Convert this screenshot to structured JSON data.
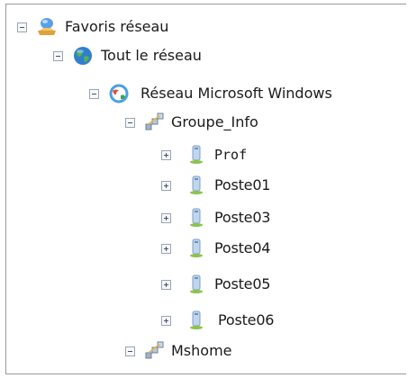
{
  "tree": {
    "favoris": {
      "label": "Favoris réseau",
      "icon": "network-favorites-icon",
      "expander": "-"
    },
    "tout": {
      "label": "Tout le réseau",
      "icon": "globe-icon",
      "expander": "-"
    },
    "msnet": {
      "label": "Réseau Microsoft Windows",
      "icon": "network-globe-icon",
      "expander": "-"
    },
    "groupe_info": {
      "label": "Groupe_Info",
      "icon": "workgroup-icon",
      "expander": "-"
    },
    "computers": [
      {
        "label": "Prof",
        "icon": "computer-icon",
        "expander": "+"
      },
      {
        "label": "Poste01",
        "icon": "computer-icon",
        "expander": "+"
      },
      {
        "label": "Poste03",
        "icon": "computer-icon",
        "expander": "+"
      },
      {
        "label": "Poste04",
        "icon": "computer-icon",
        "expander": "+"
      },
      {
        "label": "Poste05",
        "icon": "computer-icon",
        "expander": "+"
      },
      {
        "label": "Poste06",
        "icon": "computer-icon",
        "expander": "+"
      }
    ],
    "mshome": {
      "label": "Mshome",
      "icon": "workgroup-icon",
      "expander": "-"
    }
  }
}
